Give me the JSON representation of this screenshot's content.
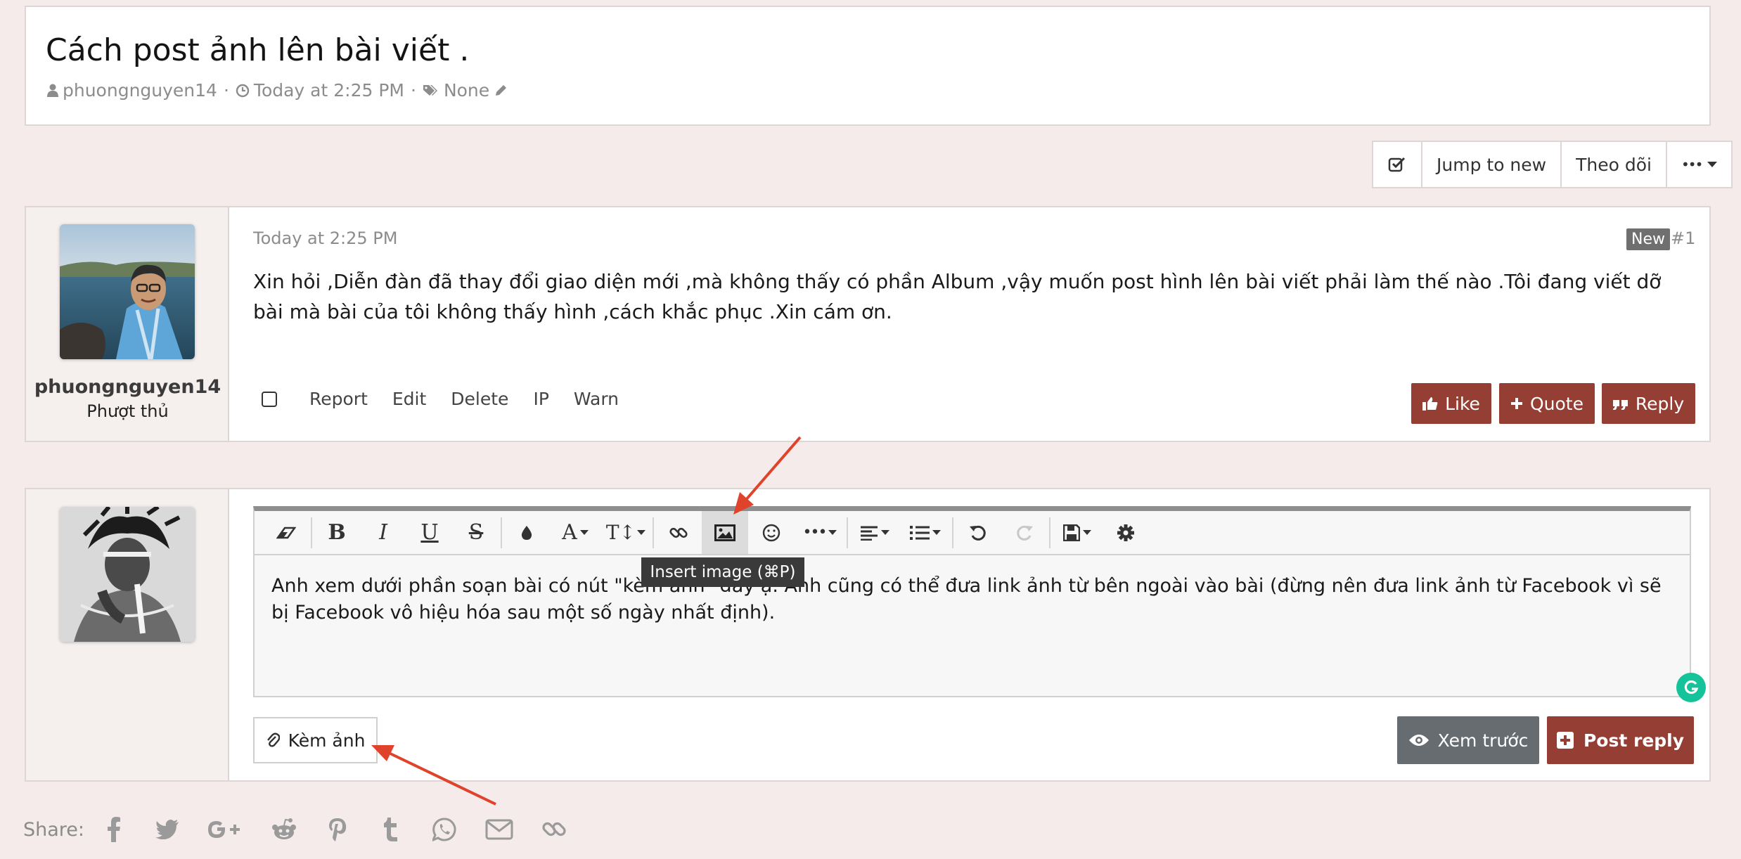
{
  "thread": {
    "title": "Cách post ảnh lên bài viết .",
    "author": "phuongnguyen14",
    "date": "Today at 2:25 PM",
    "tags": "None",
    "sep": "·"
  },
  "thread_tools": {
    "jump_to_new": "Jump to new",
    "follow": "Theo dõi",
    "more": "•••"
  },
  "post": {
    "username": "phuongnguyen14",
    "user_title": "Phượt thủ",
    "date": "Today at 2:25 PM",
    "badge": "New",
    "number": "#1",
    "body": "Xin hỏi ,Diễn đàn đã thay đổi giao diện mới ,mà không thấy có phần Album ,vậy muốn post hình lên bài viết phải làm thế nào .Tôi đang viết dỡ bài mà bài của tôi không thấy hình ,cách khắc phục .Xin cám ơn.",
    "actions": [
      "Report",
      "Edit",
      "Delete",
      "IP",
      "Warn"
    ],
    "like": "Like",
    "quote": "Quote",
    "reply": "Reply"
  },
  "editor": {
    "text": "Anh xem dưới phần soạn bài có nút \"kèm ảnh\" đây ạ. Anh cũng có thể đưa link ảnh từ bên ngoài vào bài (đừng nên đưa link ảnh từ Facebook vì sẽ bị Facebook vô hiệu hóa sau một số ngày nhất định).",
    "tooltip": "Insert image (⌘P)",
    "attach": "Kèm ảnh",
    "preview": "Xem trước",
    "post_reply": "Post reply"
  },
  "share": {
    "label": "Share:",
    "icons": [
      "facebook-icon",
      "twitter-icon",
      "google-plus-icon",
      "reddit-icon",
      "pinterest-icon",
      "tumblr-icon",
      "whatsapp-icon",
      "email-icon",
      "link-icon"
    ]
  },
  "colors": {
    "background": "#f4ebea",
    "accent": "#943e34",
    "preview": "#666c70",
    "annotation_arrow": "#e0432b"
  }
}
